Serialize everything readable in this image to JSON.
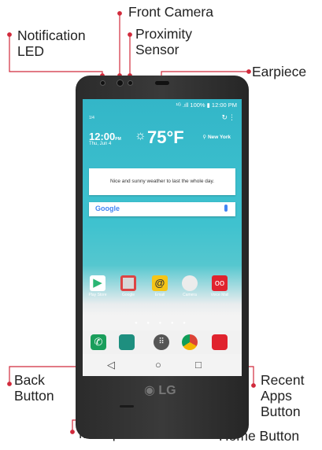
{
  "labels": {
    "front_camera": "Front Camera",
    "notification_led_1": "Notification",
    "notification_led_2": "LED",
    "proximity_1": "Proximity",
    "proximity_2": "Sensor",
    "earpiece": "Earpiece",
    "back_1": "Back",
    "back_2": "Button",
    "recent_1": "Recent",
    "recent_2": "Apps",
    "recent_3": "Button",
    "microphone": "Microphone",
    "home": "Home Button"
  },
  "screen": {
    "status": "¹ᴳ .ıll 100% ▮ 12:00 PM",
    "page_indicator": "1/4",
    "clock": "12:00",
    "clock_suffix": "PM",
    "date": "Thu, Jun 4",
    "temperature": "75°F",
    "city": "New York",
    "weather_text": "Nice and sunny weather to last the whole day.",
    "search_brand": "Google",
    "apps": [
      "Play Store",
      "Google",
      "Email",
      "Camera",
      "Voice Mail"
    ],
    "page_dots": "● ● ● ● ●"
  },
  "nav": {
    "back": "◁",
    "home": "○",
    "recent": "□"
  },
  "brand": "LG",
  "colors": {
    "leader": "#d12b3c",
    "screen_top": "#33b6c8",
    "phone_body": "#2f2f2f"
  }
}
